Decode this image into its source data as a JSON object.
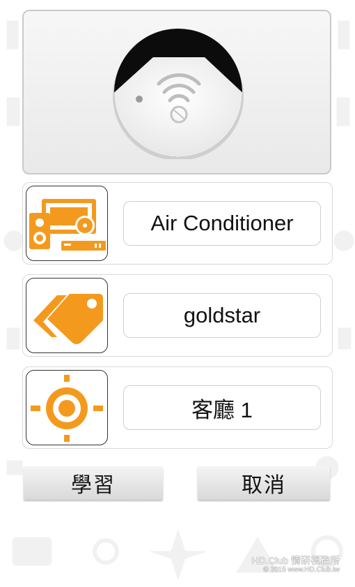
{
  "device_type": {
    "value": "Air Conditioner",
    "icon": "tv-system-icon"
  },
  "brand": {
    "value": "goldstar",
    "icon": "tag-icon"
  },
  "location": {
    "value": "客廳 1",
    "icon": "target-icon"
  },
  "buttons": {
    "learn": "學習",
    "cancel": "取消"
  },
  "watermark": {
    "line1": "HD.Club 情研視務所",
    "line2": "© 2015  www.HD.Club.tw"
  },
  "colors": {
    "accent": "#f39a1e",
    "panel": "#eeeeee"
  }
}
